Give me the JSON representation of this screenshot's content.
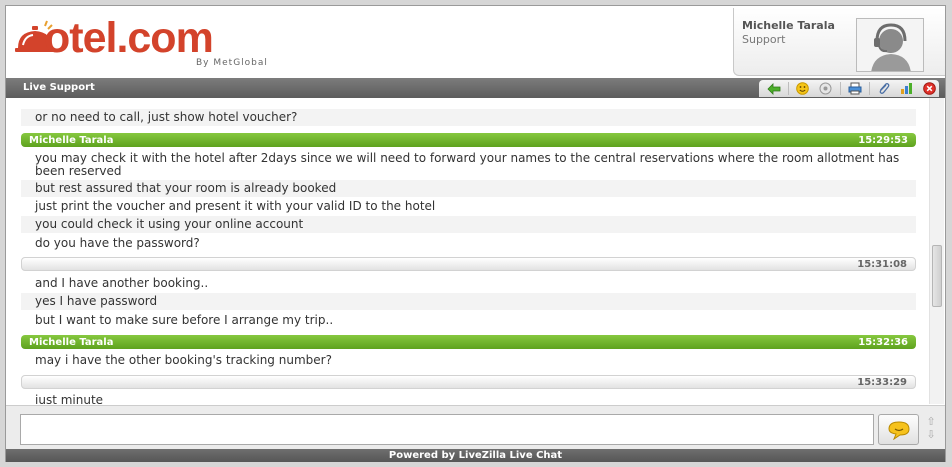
{
  "header": {
    "logo_text": "otel.com",
    "logo_sub": "By MetGlobal",
    "agent": {
      "name": "Michelle Tarala",
      "role": "Support"
    }
  },
  "titlebar": {
    "label": "Live Support"
  },
  "toolbar": {
    "icons": [
      "back-arrow-icon",
      "smiley-icon",
      "sound-icon",
      "print-icon",
      "attach-icon",
      "rate-icon",
      "close-icon"
    ]
  },
  "chat": {
    "lines": [
      {
        "text": "or no need to call, just show hotel voucher?"
      },
      {
        "text": "you may check it with the hotel after 2days since we will need to forward your names to the central reservations where the room allotment has been reserved"
      },
      {
        "text": "but rest assured that your room is already booked"
      },
      {
        "text": "just print the voucher and present it with your valid ID to the hotel"
      },
      {
        "text": "you could check it using your online account"
      },
      {
        "text": "do you have the password?"
      },
      {
        "text": "and I have another booking.."
      },
      {
        "text": "yes I have password"
      },
      {
        "text": "but I want to make sure before I arrange my trip.."
      },
      {
        "text": "may i have the other booking's tracking number?"
      },
      {
        "text": "just minute"
      }
    ],
    "headers": [
      {
        "name": "Michelle Tarala",
        "time": "15:29:53"
      },
      {
        "name": "",
        "time": "15:31:08"
      },
      {
        "name": "Michelle Tarala",
        "time": "15:32:36"
      },
      {
        "name": "",
        "time": "15:33:29"
      }
    ]
  },
  "input": {
    "placeholder": "",
    "value": ""
  },
  "footer": {
    "text": "Powered by LiveZilla Live Chat"
  },
  "colors": {
    "brand": "#d3432b",
    "agent_header": "#6cb22a",
    "bar": "#666666"
  }
}
